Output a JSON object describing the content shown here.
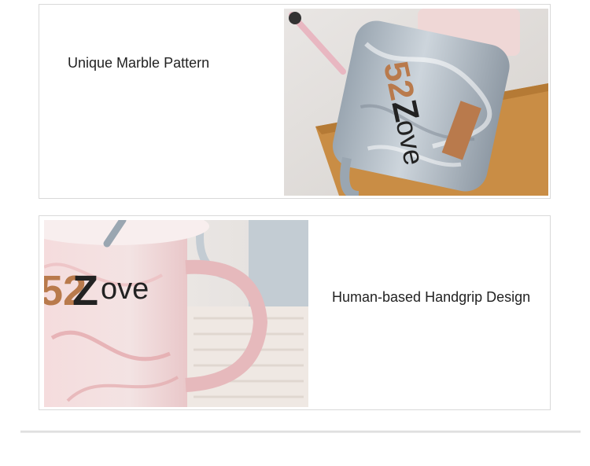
{
  "sections": [
    {
      "caption": "Unique Marble Pattern",
      "mug_brand_digits": "52",
      "mug_brand_word": "ove",
      "mug_brand_z": "Z"
    },
    {
      "caption": "Human-based Handgrip Design",
      "mug_brand_digits": "52",
      "mug_brand_word": "ove",
      "mug_brand_z": "Z"
    }
  ],
  "colors": {
    "card_border": "#d9d9d9",
    "caption_text": "#222222",
    "grey_marble": "#b9c3cc",
    "pink_marble": "#f0d3d4",
    "wood": "#c98d45",
    "copper_label": "#b97a4c"
  }
}
